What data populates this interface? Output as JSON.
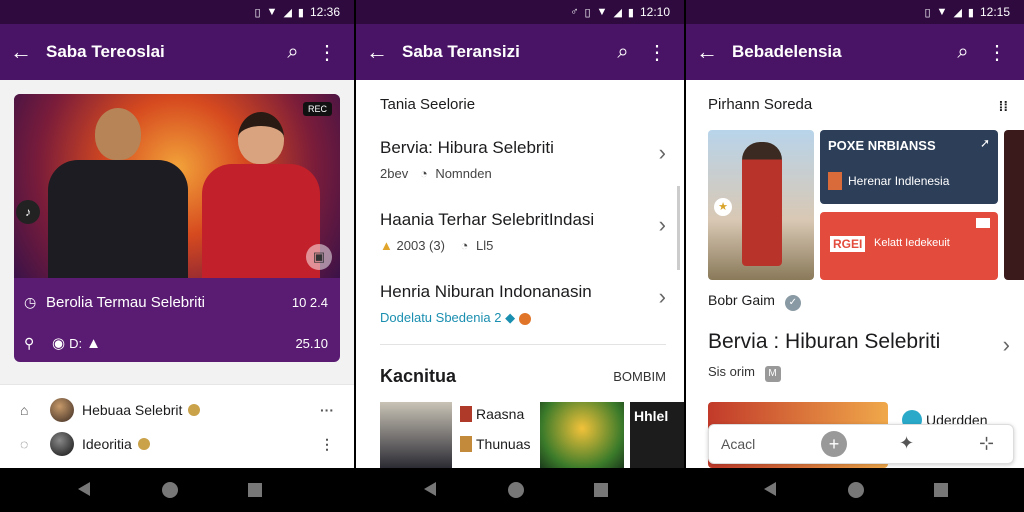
{
  "status_bar": [
    {
      "time": "12:36"
    },
    {
      "time": "12:10"
    },
    {
      "time": "12:15"
    }
  ],
  "screen1": {
    "title": "Saba Tereoslai",
    "hero": {
      "badge": "REC",
      "row1_title": "Berolia Termau Selebriti",
      "row1_value": "10 2.4",
      "row2_label": "D:",
      "row2_value": "25.10"
    },
    "list": [
      {
        "name": "Hebuaa Selebrit"
      },
      {
        "name": "Ideoritia"
      }
    ]
  },
  "screen2": {
    "title": "Saba Teransizi",
    "section": "Tania Seelorie",
    "articles": [
      {
        "title": "Bervia: Hibura Selebriti",
        "meta_a": "2bev",
        "meta_b": "Nomnden"
      },
      {
        "title": "Haania Terhar SelebritIndasi",
        "meta_a": "2003 (3)",
        "meta_b": "Ll5"
      },
      {
        "title": "Henria Niburan Indonanasin",
        "meta_teal": "Dodelatu Sbedenia 2"
      }
    ],
    "kac_title": "Kacnitua",
    "kac_right": "BOMBIM",
    "thumb_labels": [
      "Raasna",
      "Thunuas",
      "Hhlel"
    ]
  },
  "screen3": {
    "title": "Bebadelensia",
    "section": "Pirhann Soreda",
    "card_b_title": "POXE NRBIANSS",
    "card_b_sub": "Herenar Indlenesia",
    "card_c_sub": "Kelatt Iedekeuit",
    "card_c_logo": "RGEI",
    "badge": "Bobr Gaim",
    "headline": "Bervia : Hiburan Selebriti",
    "sub": "Sis orim",
    "strip_label": "Uderdden",
    "bottom_label": "Acacl"
  },
  "colors": {
    "appbar": "#4a1466",
    "statusbar": "#2e0a3f",
    "card": "#5a1c72",
    "accent_teal": "#1b8fb0"
  }
}
